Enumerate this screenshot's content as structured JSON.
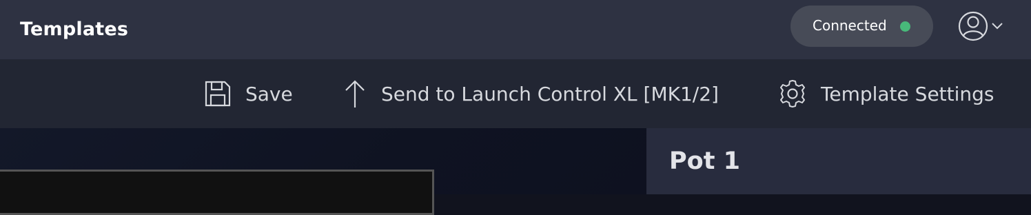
{
  "header": {
    "title": "Templates",
    "status": {
      "label": "Connected",
      "color": "#48b97a"
    },
    "user_menu": {
      "icon": "user-icon",
      "chevron": "chevron-down-icon"
    }
  },
  "toolbar": {
    "save_label": "Save",
    "send_label": "Send to Launch Control XL [MK1/2]",
    "settings_label": "Template Settings",
    "icons": [
      "save-icon",
      "upload-arrow-icon",
      "gear-icon"
    ]
  },
  "panel": {
    "title": "Pot 1"
  },
  "colors": {
    "topbar": "#2e3242",
    "toolbar": "#222633",
    "panel": "#282c3e",
    "accent_connected": "#48b97a"
  }
}
